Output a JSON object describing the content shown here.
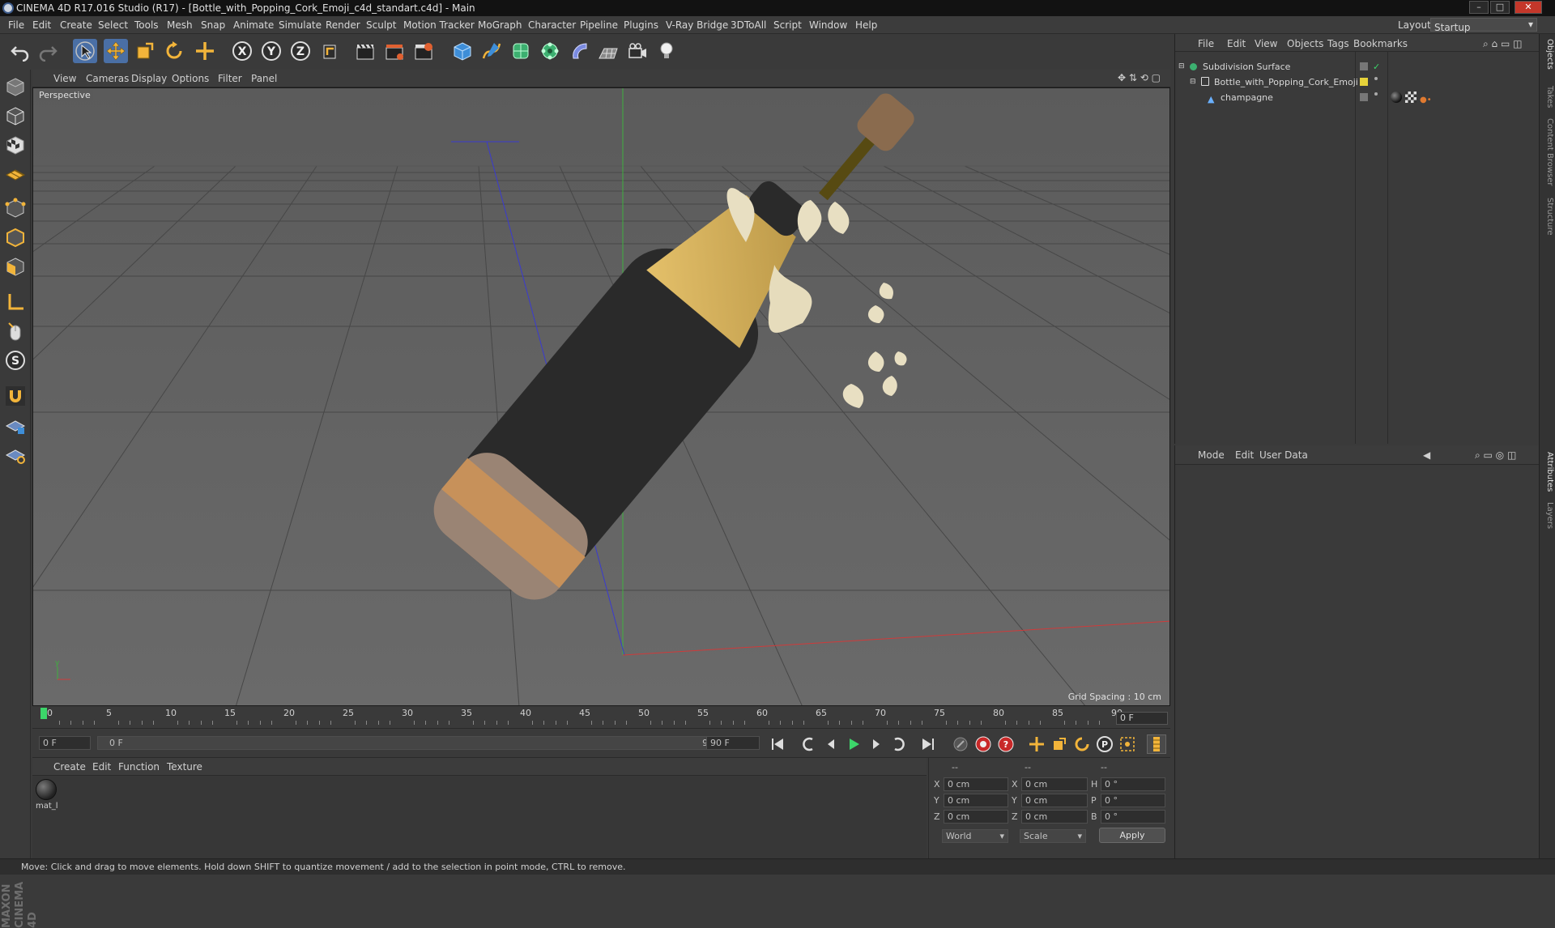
{
  "window": {
    "title": "CINEMA 4D R17.016 Studio (R17) - [Bottle_with_Popping_Cork_Emoji_c4d_standart.c4d] - Main"
  },
  "menubar": {
    "items": [
      "File",
      "Edit",
      "Create",
      "Select",
      "Tools",
      "Mesh",
      "Snap",
      "Animate",
      "Simulate",
      "Render",
      "Sculpt",
      "Motion Tracker",
      "MoGraph",
      "Character",
      "Pipeline",
      "Plugins",
      "V-Ray Bridge",
      "3DToAll",
      "Script",
      "Window",
      "Help"
    ],
    "layout_label": "Layout:",
    "layout_value": "Startup"
  },
  "viewport": {
    "menu": [
      "View",
      "Cameras",
      "Display",
      "Options",
      "Filter",
      "Panel"
    ],
    "label": "Perspective",
    "grid_spacing": "Grid Spacing : 10 cm"
  },
  "timeline": {
    "ticks": [
      "0",
      "5",
      "10",
      "15",
      "20",
      "25",
      "30",
      "35",
      "40",
      "45",
      "50",
      "55",
      "60",
      "65",
      "70",
      "75",
      "80",
      "85",
      "90"
    ],
    "end_field": "0 F"
  },
  "transport": {
    "start_field": "0 F",
    "range_start": "0 F",
    "range_end": "90 F",
    "end_field": "90 F"
  },
  "material": {
    "menu": [
      "Create",
      "Edit",
      "Function",
      "Texture"
    ],
    "items": [
      {
        "name": "mat_l"
      }
    ]
  },
  "coordinates": {
    "headers": [
      "--",
      "--",
      "--"
    ],
    "rows": [
      {
        "l1": "X",
        "v1": "0 cm",
        "l2": "X",
        "v2": "0 cm",
        "l3": "H",
        "v3": "0 °"
      },
      {
        "l1": "Y",
        "v1": "0 cm",
        "l2": "Y",
        "v2": "0 cm",
        "l3": "P",
        "v3": "0 °"
      },
      {
        "l1": "Z",
        "v1": "0 cm",
        "l2": "Z",
        "v2": "0 cm",
        "l3": "B",
        "v3": "0 °"
      }
    ],
    "world": "World",
    "scale": "Scale",
    "apply": "Apply"
  },
  "objects": {
    "menu": [
      "File",
      "Edit",
      "View",
      "Objects",
      "Tags",
      "Bookmarks"
    ],
    "items": [
      {
        "name": "Subdivision Surface"
      },
      {
        "name": "Bottle_with_Popping_Cork_Emoji"
      },
      {
        "name": "champagne"
      }
    ]
  },
  "attributes": {
    "menu": [
      "Mode",
      "Edit",
      "User Data"
    ]
  },
  "sidetabs": [
    "Objects",
    "Takes",
    "Content Browser",
    "Structure",
    "Attributes",
    "Layers"
  ],
  "status": {
    "text": "Move: Click and drag to move elements. Hold down SHIFT to quantize movement / add to the selection in point mode, CTRL to remove."
  },
  "branding": {
    "logo": "MAXON CINEMA 4D"
  },
  "colors": {
    "accent": "#4d8fd6",
    "active_tool": "#4a6fa5",
    "timeline_marker": "#3cd66a"
  }
}
